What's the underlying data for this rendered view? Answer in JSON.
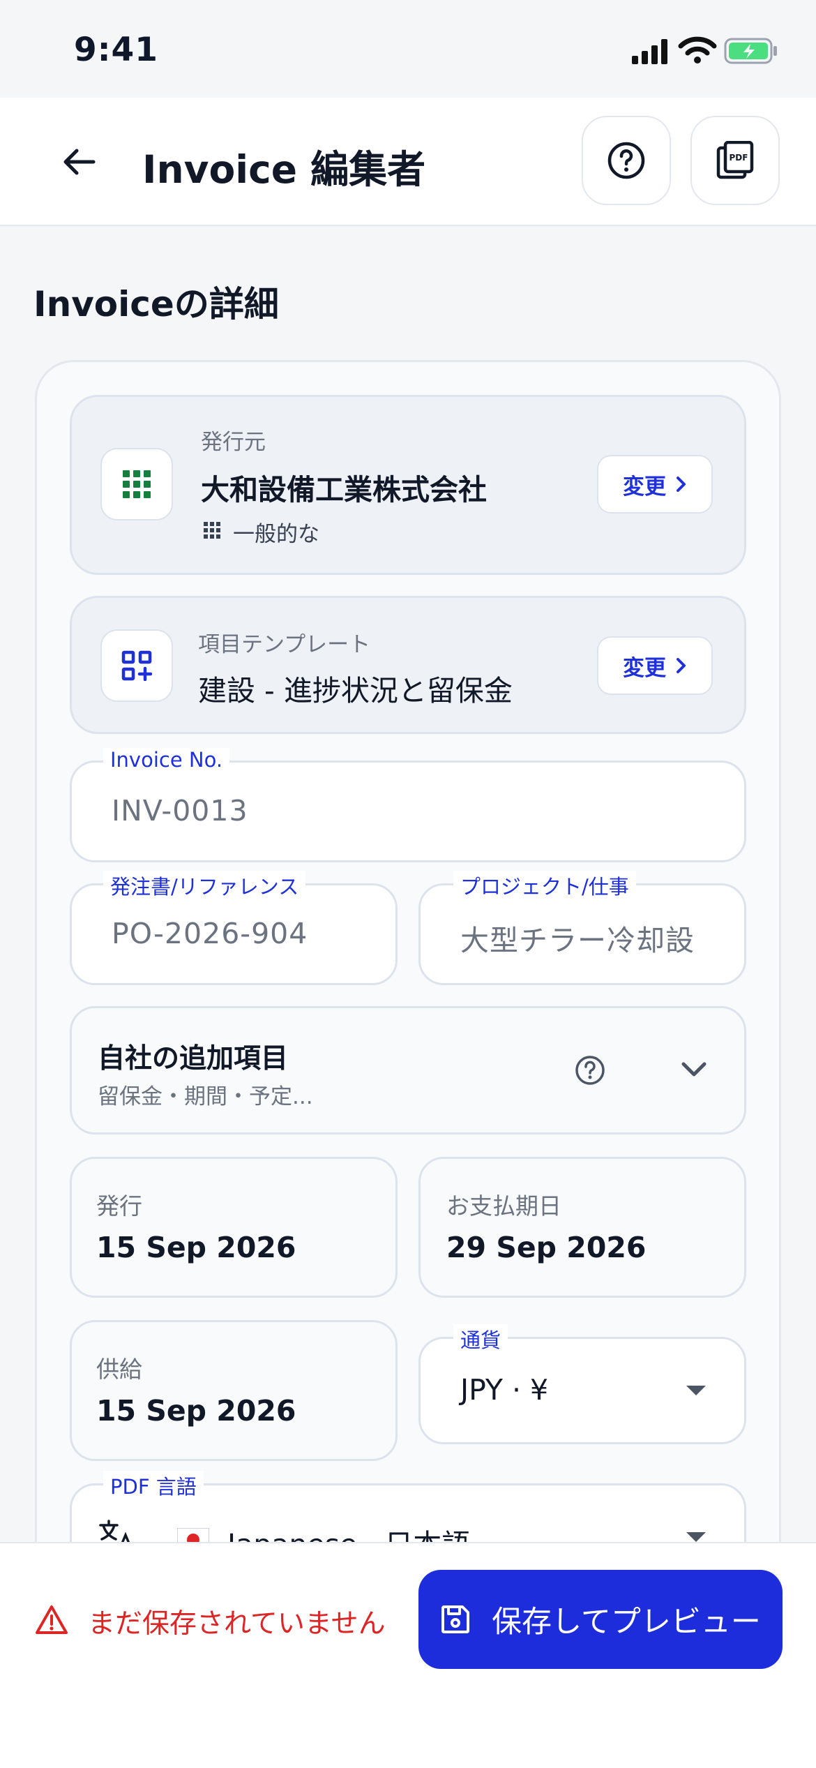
{
  "status_bar": {
    "time": "9:41"
  },
  "header": {
    "title": "Invoice 編集者"
  },
  "section_title": "Invoiceの詳細",
  "issuer": {
    "label": "発行元",
    "name": "大和設備工業株式会社",
    "type": "一般的な",
    "change_label": "変更"
  },
  "item_template": {
    "label": "項目テンプレート",
    "value": "建設 - 進捗状況と留保金",
    "change_label": "変更"
  },
  "invoice_no": {
    "label": "Invoice No.",
    "placeholder": "INV-0013"
  },
  "po_reference": {
    "label": "発注書/リファレンス",
    "placeholder": "PO-2026-904"
  },
  "project": {
    "label": "プロジェクト/仕事",
    "placeholder": "大型チラー冷却設"
  },
  "custom_fields": {
    "title": "自社の追加項目",
    "subtitle": "留保金・期間・予定..."
  },
  "dates": {
    "issue_label": "発行",
    "issue_value": "15 Sep 2026",
    "due_label": "お支払期日",
    "due_value": "29 Sep 2026",
    "supply_label": "供給",
    "supply_value": "15 Sep 2026"
  },
  "currency": {
    "label": "通貨",
    "value": "JPY · ¥"
  },
  "pdf_language": {
    "label": "PDF 言語",
    "value": "Japanese · 日本語"
  },
  "footer": {
    "unsaved_text": "まだ保存されていません",
    "save_label": "保存してプレビュー"
  },
  "colors": {
    "accent": "#1e2ddb",
    "warning": "#dc2626",
    "issuer_icon": "#15803d"
  }
}
